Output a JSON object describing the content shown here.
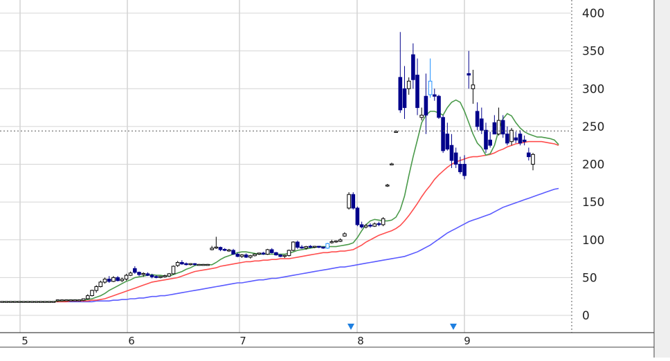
{
  "chart_data": {
    "type": "candlestick",
    "x_tick_labels": [
      "5",
      "6",
      "7",
      "8",
      "9"
    ],
    "y_ticks": [
      0,
      50,
      100,
      150,
      200,
      250,
      300,
      350,
      400
    ],
    "ylim": [
      -25,
      418
    ],
    "price_marker": {
      "value": 244,
      "label": "244",
      "color": "#e8400c"
    },
    "event_markers": [
      "8",
      "9"
    ],
    "colors": {
      "up": "#ffffff",
      "down": "#00008b",
      "highlight": "#1e90ff",
      "ma_short": "#4a9a4a",
      "ma_mid": "#ff4d4d",
      "ma_long": "#5a5aff",
      "grid": "#d4d4d4",
      "panel": "#efefef"
    },
    "candles": [
      {
        "o": 18,
        "h": 18,
        "l": 18,
        "c": 18
      },
      {
        "o": 18,
        "h": 18,
        "l": 18,
        "c": 18
      },
      {
        "o": 18,
        "h": 18,
        "l": 18,
        "c": 18
      },
      {
        "o": 18,
        "h": 18,
        "l": 18,
        "c": 18
      },
      {
        "o": 18,
        "h": 18,
        "l": 18,
        "c": 18
      },
      {
        "o": 18,
        "h": 18,
        "l": 18,
        "c": 18
      },
      {
        "o": 18,
        "h": 18,
        "l": 18,
        "c": 18
      },
      {
        "o": 18,
        "h": 18,
        "l": 18,
        "c": 18
      },
      {
        "o": 18,
        "h": 18,
        "l": 18,
        "c": 18
      },
      {
        "o": 18,
        "h": 18,
        "l": 18,
        "c": 18
      },
      {
        "o": 18,
        "h": 18,
        "l": 18,
        "c": 18
      },
      {
        "o": 18,
        "h": 18,
        "l": 18,
        "c": 18
      },
      {
        "o": 18,
        "h": 18,
        "l": 18,
        "c": 18
      },
      {
        "o": 19,
        "h": 21,
        "l": 18,
        "c": 20
      },
      {
        "o": 20,
        "h": 21,
        "l": 19,
        "c": 20
      },
      {
        "o": 20,
        "h": 21,
        "l": 19,
        "c": 20
      },
      {
        "o": 20,
        "h": 21,
        "l": 19,
        "c": 20
      },
      {
        "o": 20,
        "h": 21,
        "l": 19,
        "c": 20
      },
      {
        "o": 20,
        "h": 21,
        "l": 19,
        "c": 20
      },
      {
        "o": 20,
        "h": 22,
        "l": 19,
        "c": 22
      },
      {
        "o": 22,
        "h": 28,
        "l": 21,
        "c": 26
      },
      {
        "o": 26,
        "h": 34,
        "l": 25,
        "c": 33
      },
      {
        "o": 33,
        "h": 40,
        "l": 30,
        "c": 38
      },
      {
        "o": 38,
        "h": 46,
        "l": 37,
        "c": 44
      },
      {
        "o": 44,
        "h": 50,
        "l": 42,
        "c": 48
      },
      {
        "o": 48,
        "h": 52,
        "l": 43,
        "c": 45
      },
      {
        "o": 45,
        "h": 52,
        "l": 44,
        "c": 50
      },
      {
        "o": 50,
        "h": 52,
        "l": 45,
        "c": 46
      },
      {
        "o": 46,
        "h": 50,
        "l": 44,
        "c": 48
      },
      {
        "o": 48,
        "h": 55,
        "l": 46,
        "c": 53
      },
      {
        "o": 53,
        "h": 58,
        "l": 52,
        "c": 56
      },
      {
        "o": 62,
        "h": 65,
        "l": 55,
        "c": 57
      },
      {
        "o": 57,
        "h": 58,
        "l": 52,
        "c": 54
      },
      {
        "o": 54,
        "h": 57,
        "l": 51,
        "c": 55
      },
      {
        "o": 55,
        "h": 57,
        "l": 52,
        "c": 53
      },
      {
        "o": 53,
        "h": 55,
        "l": 49,
        "c": 51
      },
      {
        "o": 51,
        "h": 53,
        "l": 49,
        "c": 50
      },
      {
        "o": 50,
        "h": 52,
        "l": 49,
        "c": 51
      },
      {
        "o": 51,
        "h": 54,
        "l": 50,
        "c": 52
      },
      {
        "o": 52,
        "h": 56,
        "l": 51,
        "c": 55
      },
      {
        "o": 55,
        "h": 66,
        "l": 54,
        "c": 65
      },
      {
        "o": 66,
        "h": 72,
        "l": 64,
        "c": 70
      },
      {
        "o": 70,
        "h": 73,
        "l": 67,
        "c": 68
      },
      {
        "o": 68,
        "h": 70,
        "l": 66,
        "c": 67
      },
      {
        "o": 67,
        "h": 69,
        "l": 66,
        "c": 68
      },
      {
        "o": 68,
        "h": 69,
        "l": 66,
        "c": 67
      },
      {
        "o": 67,
        "h": 68,
        "l": 66,
        "c": 67
      },
      {
        "o": 67,
        "h": 68,
        "l": 66,
        "c": 67
      },
      {
        "o": 67,
        "h": 68,
        "l": 66,
        "c": 67
      },
      {
        "o": 87,
        "h": 92,
        "l": 86,
        "c": 89
      },
      {
        "o": 89,
        "h": 104,
        "l": 88,
        "c": 90
      },
      {
        "o": 90,
        "h": 91,
        "l": 85,
        "c": 87
      },
      {
        "o": 87,
        "h": 89,
        "l": 85,
        "c": 86
      },
      {
        "o": 86,
        "h": 88,
        "l": 84,
        "c": 86
      },
      {
        "o": 86,
        "h": 88,
        "l": 80,
        "c": 81
      },
      {
        "o": 81,
        "h": 83,
        "l": 77,
        "c": 78
      },
      {
        "o": 78,
        "h": 81,
        "l": 76,
        "c": 80
      },
      {
        "o": 80,
        "h": 82,
        "l": 76,
        "c": 77
      },
      {
        "o": 77,
        "h": 80,
        "l": 75,
        "c": 79
      },
      {
        "o": 79,
        "h": 82,
        "l": 78,
        "c": 81
      },
      {
        "o": 81,
        "h": 83,
        "l": 80,
        "c": 82
      },
      {
        "o": 82,
        "h": 84,
        "l": 80,
        "c": 81
      },
      {
        "o": 81,
        "h": 88,
        "l": 80,
        "c": 87
      },
      {
        "o": 87,
        "h": 89,
        "l": 82,
        "c": 83
      },
      {
        "o": 83,
        "h": 84,
        "l": 79,
        "c": 80
      },
      {
        "o": 80,
        "h": 81,
        "l": 77,
        "c": 78
      },
      {
        "o": 78,
        "h": 80,
        "l": 76,
        "c": 79
      },
      {
        "o": 79,
        "h": 87,
        "l": 78,
        "c": 86
      },
      {
        "o": 86,
        "h": 98,
        "l": 85,
        "c": 97
      },
      {
        "o": 97,
        "h": 99,
        "l": 88,
        "c": 90
      },
      {
        "o": 90,
        "h": 93,
        "l": 88,
        "c": 89
      },
      {
        "o": 89,
        "h": 92,
        "l": 87,
        "c": 91
      },
      {
        "o": 91,
        "h": 93,
        "l": 89,
        "c": 90
      },
      {
        "o": 90,
        "h": 92,
        "l": 89,
        "c": 91
      },
      {
        "o": 91,
        "h": 92,
        "l": 89,
        "c": 90
      },
      {
        "o": 90,
        "h": 91,
        "l": 88,
        "c": 89
      },
      {
        "o": 89,
        "h": 96,
        "l": 88,
        "c": 95,
        "hl": true
      },
      {
        "o": 97,
        "h": 100,
        "l": 95,
        "c": 97
      },
      {
        "o": 97,
        "h": 99,
        "l": 96,
        "c": 98
      },
      {
        "o": 98,
        "h": 102,
        "l": 97,
        "c": 100
      },
      {
        "o": 105,
        "h": 110,
        "l": 104,
        "c": 108
      },
      {
        "o": 142,
        "h": 163,
        "l": 140,
        "c": 160
      },
      {
        "o": 160,
        "h": 163,
        "l": 140,
        "c": 142
      },
      {
        "o": 142,
        "h": 144,
        "l": 118,
        "c": 120
      },
      {
        "o": 120,
        "h": 124,
        "l": 115,
        "c": 117
      },
      {
        "o": 117,
        "h": 121,
        "l": 115,
        "c": 119
      },
      {
        "o": 119,
        "h": 122,
        "l": 116,
        "c": 118
      },
      {
        "o": 118,
        "h": 123,
        "l": 117,
        "c": 121
      },
      {
        "o": 121,
        "h": 124,
        "l": 118,
        "c": 120
      },
      {
        "o": 120,
        "h": 130,
        "l": 118,
        "c": 128
      },
      {
        "o": 172,
        "h": 174,
        "l": 170,
        "c": 172
      },
      {
        "o": 200,
        "h": 202,
        "l": 199,
        "c": 200
      },
      {
        "o": 243,
        "h": 245,
        "l": 242,
        "c": 243
      },
      {
        "o": 315,
        "h": 375,
        "l": 268,
        "c": 272
      },
      {
        "o": 300,
        "h": 330,
        "l": 260,
        "c": 275
      },
      {
        "o": 300,
        "h": 315,
        "l": 292,
        "c": 310
      },
      {
        "o": 345,
        "h": 360,
        "l": 300,
        "c": 312
      },
      {
        "o": 318,
        "h": 340,
        "l": 265,
        "c": 275
      },
      {
        "o": 262,
        "h": 275,
        "l": 258,
        "c": 265
      },
      {
        "o": 290,
        "h": 320,
        "l": 240,
        "c": 265
      },
      {
        "o": 292,
        "h": 340,
        "l": 288,
        "c": 310,
        "hl": true
      },
      {
        "o": 292,
        "h": 300,
        "l": 284,
        "c": 290
      },
      {
        "o": 290,
        "h": 292,
        "l": 260,
        "c": 262
      },
      {
        "o": 262,
        "h": 265,
        "l": 215,
        "c": 218
      },
      {
        "o": 240,
        "h": 255,
        "l": 218,
        "c": 220
      },
      {
        "o": 225,
        "h": 240,
        "l": 195,
        "c": 205
      },
      {
        "o": 215,
        "h": 222,
        "l": 195,
        "c": 200
      },
      {
        "o": 200,
        "h": 210,
        "l": 187,
        "c": 190
      },
      {
        "o": 200,
        "h": 212,
        "l": 180,
        "c": 185
      },
      {
        "o": 320,
        "h": 350,
        "l": 300,
        "c": 318
      },
      {
        "o": 300,
        "h": 325,
        "l": 280,
        "c": 305
      },
      {
        "o": 270,
        "h": 282,
        "l": 245,
        "c": 250
      },
      {
        "o": 260,
        "h": 275,
        "l": 240,
        "c": 245
      },
      {
        "o": 245,
        "h": 255,
        "l": 215,
        "c": 220
      },
      {
        "o": 232,
        "h": 243,
        "l": 222,
        "c": 225
      },
      {
        "o": 255,
        "h": 265,
        "l": 240,
        "c": 240
      },
      {
        "o": 240,
        "h": 275,
        "l": 238,
        "c": 258
      },
      {
        "o": 258,
        "h": 265,
        "l": 235,
        "c": 240
      },
      {
        "o": 240,
        "h": 250,
        "l": 225,
        "c": 228
      },
      {
        "o": 230,
        "h": 248,
        "l": 225,
        "c": 245
      },
      {
        "o": 235,
        "h": 243,
        "l": 228,
        "c": 232
      },
      {
        "o": 240,
        "h": 245,
        "l": 225,
        "c": 228
      },
      {
        "o": 232,
        "h": 238,
        "l": 225,
        "c": 230
      },
      {
        "o": 215,
        "h": 222,
        "l": 205,
        "c": 210
      },
      {
        "o": 200,
        "h": 215,
        "l": 192,
        "c": 213
      }
    ],
    "ma_short": [
      18,
      18,
      18,
      18,
      18,
      18,
      18,
      18,
      18,
      18,
      18,
      18,
      18,
      19,
      19,
      20,
      20,
      20,
      20,
      20,
      21,
      22,
      24,
      26,
      29,
      33,
      36,
      39,
      42,
      45,
      47,
      50,
      51,
      52,
      53,
      54,
      53,
      53,
      52,
      52,
      54,
      56,
      58,
      61,
      63,
      66,
      67,
      67,
      67,
      67,
      70,
      74,
      77,
      79,
      81,
      83,
      84,
      84,
      83,
      82,
      81,
      81,
      81,
      81,
      81,
      81,
      81,
      82,
      84,
      86,
      87,
      88,
      89,
      90,
      91,
      91,
      91,
      91,
      91,
      92,
      93,
      94,
      96,
      103,
      112,
      120,
      125,
      127,
      126,
      125,
      125,
      126,
      130,
      140,
      158,
      185,
      210,
      232,
      255,
      265,
      270,
      270,
      268,
      265,
      275,
      282,
      285,
      282,
      270,
      255,
      240,
      228,
      222,
      212,
      214,
      225,
      245,
      260,
      267,
      264,
      255,
      248,
      243,
      240,
      238,
      236,
      236,
      235,
      234,
      232,
      226
    ],
    "ma_mid": [
      18,
      18,
      18,
      18,
      18,
      18,
      18,
      18,
      18,
      18,
      18,
      18,
      18,
      18,
      18,
      18,
      19,
      19,
      19,
      19,
      19,
      20,
      20,
      21,
      22,
      24,
      26,
      28,
      30,
      32,
      34,
      36,
      38,
      40,
      42,
      44,
      45,
      46,
      47,
      48,
      49,
      50,
      52,
      54,
      56,
      58,
      59,
      60,
      61,
      62,
      63,
      65,
      66,
      67,
      68,
      69,
      70,
      71,
      71,
      72,
      72,
      73,
      73,
      74,
      74,
      75,
      75,
      75,
      76,
      77,
      78,
      79,
      80,
      81,
      82,
      83,
      83,
      84,
      84,
      85,
      85,
      86,
      87,
      90,
      93,
      97,
      100,
      103,
      106,
      108,
      110,
      112,
      115,
      119,
      125,
      132,
      140,
      148,
      157,
      165,
      172,
      180,
      186,
      191,
      196,
      200,
      203,
      205,
      207,
      209,
      210,
      210,
      211,
      212,
      213,
      215,
      218,
      220,
      223,
      225,
      227,
      228,
      229,
      230,
      230,
      230,
      230,
      229,
      228,
      227,
      225
    ],
    "ma_long": [
      18,
      18,
      18,
      18,
      18,
      18,
      18,
      18,
      18,
      18,
      18,
      18,
      18,
      18,
      18,
      18,
      18,
      18,
      18,
      18,
      18,
      18,
      19,
      19,
      19,
      19,
      20,
      20,
      21,
      21,
      22,
      22,
      23,
      23,
      24,
      25,
      25,
      26,
      26,
      27,
      28,
      29,
      30,
      31,
      32,
      33,
      34,
      35,
      36,
      37,
      38,
      39,
      40,
      41,
      42,
      43,
      43,
      44,
      45,
      46,
      47,
      47,
      48,
      49,
      49,
      50,
      51,
      52,
      53,
      54,
      55,
      56,
      57,
      58,
      59,
      60,
      61,
      62,
      63,
      64,
      64,
      65,
      66,
      67,
      68,
      69,
      70,
      71,
      72,
      73,
      74,
      75,
      76,
      77,
      78,
      80,
      82,
      84,
      87,
      90,
      93,
      97,
      101,
      105,
      109,
      112,
      115,
      118,
      121,
      124,
      126,
      128,
      130,
      132,
      134,
      137,
      140,
      143,
      145,
      147,
      149,
      151,
      153,
      155,
      157,
      159,
      161,
      163,
      165,
      167,
      168
    ]
  }
}
